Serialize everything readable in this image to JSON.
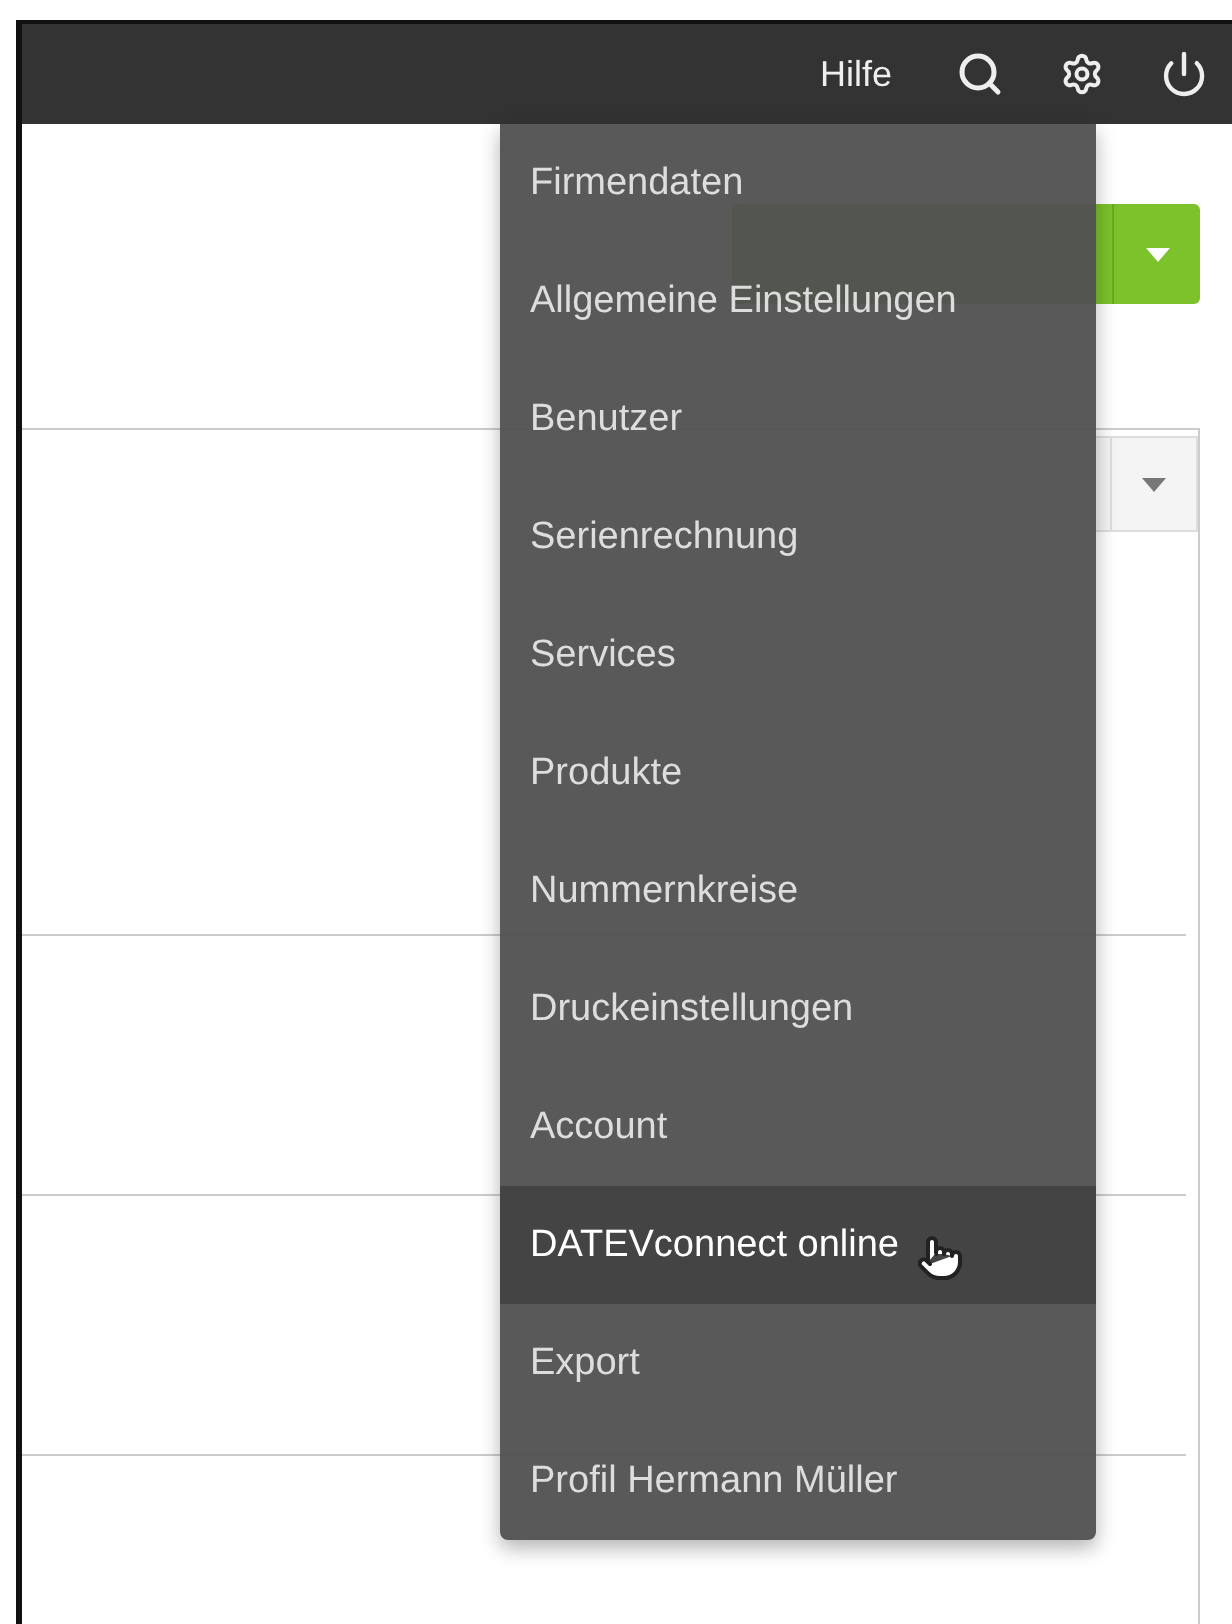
{
  "topbar": {
    "help_link": "Hilfe"
  },
  "settings_menu": {
    "items": [
      {
        "label": "Firmendaten",
        "hovered": false
      },
      {
        "label": "Allgemeine Einstellungen",
        "hovered": false
      },
      {
        "label": "Benutzer",
        "hovered": false
      },
      {
        "label": "Serienrechnung",
        "hovered": false
      },
      {
        "label": "Services",
        "hovered": false
      },
      {
        "label": "Produkte",
        "hovered": false
      },
      {
        "label": "Nummernkreise",
        "hovered": false
      },
      {
        "label": "Druckeinstellungen",
        "hovered": false
      },
      {
        "label": "Account",
        "hovered": false
      },
      {
        "label": "DATEVconnect online",
        "hovered": true
      },
      {
        "label": "Export",
        "hovered": false
      },
      {
        "label": "Profil Hermann Müller",
        "hovered": false
      }
    ]
  }
}
